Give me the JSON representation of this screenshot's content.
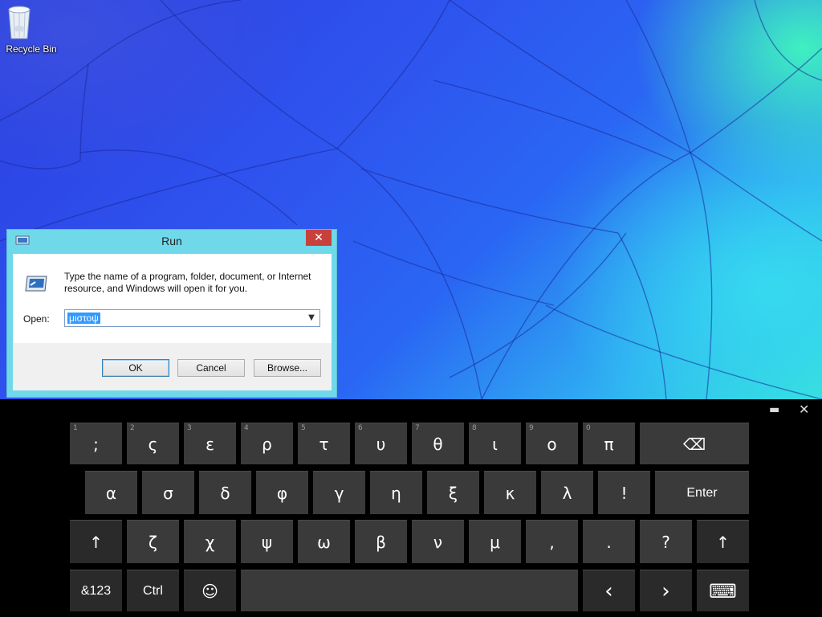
{
  "desktop": {
    "icons": [
      {
        "label": "Recycle Bin",
        "icon": "recycle-bin-icon"
      }
    ]
  },
  "run_dialog": {
    "title": "Run",
    "close_label": "✕",
    "instructions": "Type the name of a program, folder, document, or Internet resource, and Windows will open it for you.",
    "open_label": "Open:",
    "open_value": "μιστοψ",
    "buttons": {
      "ok": "OK",
      "cancel": "Cancel",
      "browse": "Browse..."
    }
  },
  "keyboard": {
    "controls": {
      "dock": "▬",
      "close": "✕"
    },
    "row1": [
      {
        "num": "1",
        "label": ";"
      },
      {
        "num": "2",
        "label": "ς"
      },
      {
        "num": "3",
        "label": "ε"
      },
      {
        "num": "4",
        "label": "ρ"
      },
      {
        "num": "5",
        "label": "τ"
      },
      {
        "num": "6",
        "label": "υ"
      },
      {
        "num": "7",
        "label": "θ"
      },
      {
        "num": "8",
        "label": "ι"
      },
      {
        "num": "9",
        "label": "ο"
      },
      {
        "num": "0",
        "label": "π"
      }
    ],
    "backspace": "⌫",
    "row2": [
      "α",
      "σ",
      "δ",
      "φ",
      "γ",
      "η",
      "ξ",
      "κ",
      "λ",
      "!"
    ],
    "enter": "Enter",
    "shift": "↑",
    "row3": [
      "ζ",
      "χ",
      "ψ",
      "ω",
      "β",
      "ν",
      "μ",
      ",",
      ".",
      "?"
    ],
    "row4": {
      "sym": "&123",
      "ctrl": "Ctrl",
      "emoji": "☺",
      "left": "‹",
      "right": "›",
      "kbd": "⌨"
    }
  }
}
